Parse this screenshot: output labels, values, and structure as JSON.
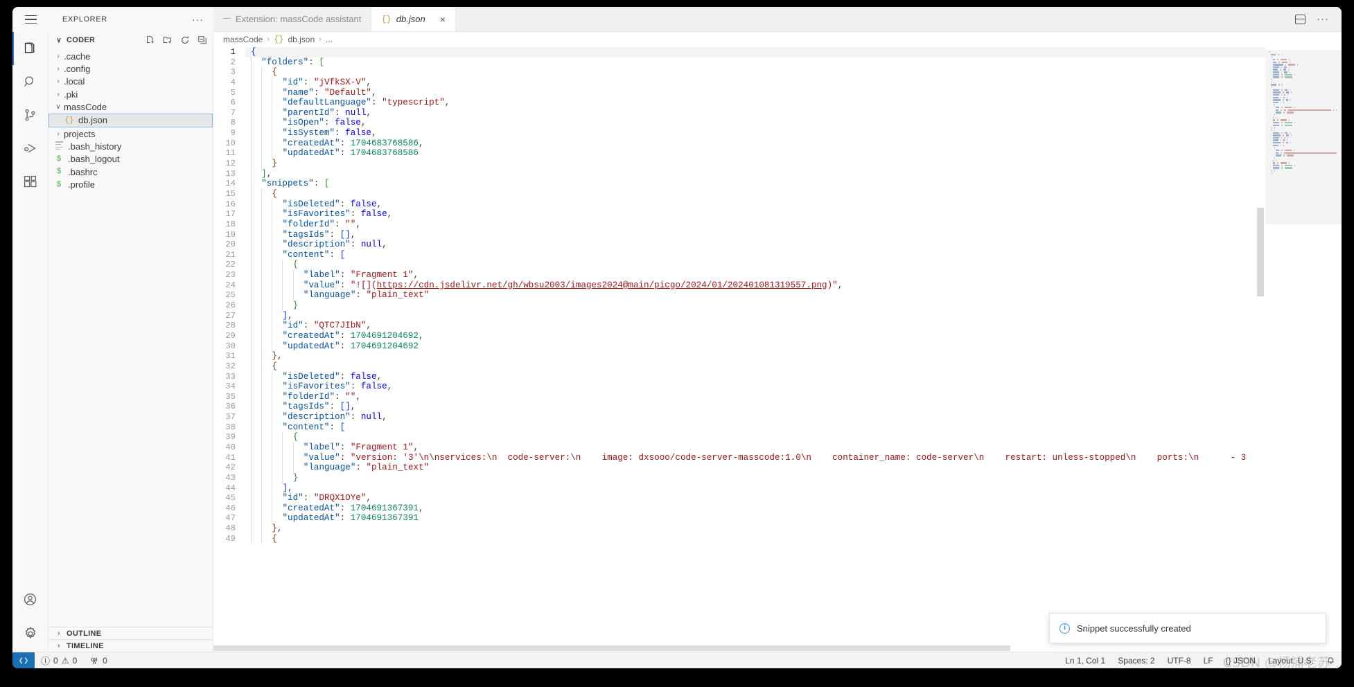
{
  "window": {
    "hamburger_icon": "hamburger-menu-icon"
  },
  "sidebar": {
    "title": "EXPLORER",
    "more_actions": "···",
    "root": {
      "label": "CODER",
      "chevron": "∨",
      "actions": [
        "new-file-icon",
        "new-folder-icon",
        "refresh-icon",
        "collapse-all-icon"
      ]
    },
    "items": [
      {
        "label": ".cache",
        "type": "folder",
        "chevron": "›",
        "icon": "",
        "selected": false
      },
      {
        "label": ".config",
        "type": "folder",
        "chevron": "›",
        "icon": "",
        "selected": false
      },
      {
        "label": ".local",
        "type": "folder",
        "chevron": "›",
        "icon": "",
        "selected": false
      },
      {
        "label": ".pki",
        "type": "folder",
        "chevron": "›",
        "icon": "",
        "selected": false
      },
      {
        "label": "massCode",
        "type": "folder-open",
        "chevron": "∨",
        "icon": "",
        "selected": false
      },
      {
        "label": "db.json",
        "type": "json-file",
        "chevron": "",
        "icon": "{}",
        "selected": true
      },
      {
        "label": "projects",
        "type": "folder",
        "chevron": "›",
        "icon": "",
        "selected": false
      },
      {
        "label": ".bash_history",
        "type": "text-file",
        "chevron": "",
        "icon": "lines",
        "selected": false
      },
      {
        "label": ".bash_logout",
        "type": "shell-file",
        "chevron": "",
        "icon": "$",
        "selected": false
      },
      {
        "label": ".bashrc",
        "type": "shell-file",
        "chevron": "",
        "icon": "$",
        "selected": false
      },
      {
        "label": ".profile",
        "type": "shell-file",
        "chevron": "",
        "icon": "$",
        "selected": false
      }
    ],
    "panels": [
      {
        "label": "OUTLINE",
        "chevron": "›"
      },
      {
        "label": "TIMELINE",
        "chevron": "›"
      }
    ]
  },
  "activitybar": {
    "top": [
      {
        "name": "explorer",
        "icon": "files-icon",
        "active": true
      },
      {
        "name": "search",
        "icon": "search-icon",
        "active": false
      },
      {
        "name": "source-control",
        "icon": "source-control-icon",
        "active": false
      },
      {
        "name": "run-and-debug",
        "icon": "run-debug-icon",
        "active": false
      },
      {
        "name": "extensions",
        "icon": "extensions-icon",
        "active": false
      }
    ],
    "bottom": [
      {
        "name": "accounts",
        "icon": "account-icon"
      },
      {
        "name": "manage",
        "icon": "gear-icon"
      }
    ]
  },
  "tabs": [
    {
      "label": "Extension: massCode assistant",
      "icon": "lines-icon",
      "active": false,
      "closable": false
    },
    {
      "label": "db.json",
      "icon": "json-icon",
      "active": true,
      "closable": true,
      "close_label": "×"
    }
  ],
  "editor_actions": [
    {
      "name": "split-editor-down",
      "icon": "split-editor-icon"
    },
    {
      "name": "more-actions",
      "icon": "ellipsis-icon"
    }
  ],
  "breadcrumb": [
    "massCode",
    "db.json",
    "..."
  ],
  "breadcrumb_icon": "{}",
  "code": {
    "current_line": 1,
    "lines": [
      {
        "n": 1,
        "indent": 0,
        "segs": [
          {
            "t": "{",
            "c": "br1"
          }
        ]
      },
      {
        "n": 2,
        "indent": 1,
        "segs": [
          {
            "t": "\"folders\"",
            "c": "k"
          },
          {
            "t": ": ",
            "c": "p"
          },
          {
            "t": "[",
            "c": "br2"
          }
        ]
      },
      {
        "n": 3,
        "indent": 2,
        "segs": [
          {
            "t": "{",
            "c": "br3"
          }
        ]
      },
      {
        "n": 4,
        "indent": 3,
        "segs": [
          {
            "t": "\"id\"",
            "c": "k"
          },
          {
            "t": ": ",
            "c": "p"
          },
          {
            "t": "\"jVfkSX-V\"",
            "c": "s"
          },
          {
            "t": ",",
            "c": "p"
          }
        ]
      },
      {
        "n": 5,
        "indent": 3,
        "segs": [
          {
            "t": "\"name\"",
            "c": "k"
          },
          {
            "t": ": ",
            "c": "p"
          },
          {
            "t": "\"Default\"",
            "c": "s"
          },
          {
            "t": ",",
            "c": "p"
          }
        ]
      },
      {
        "n": 6,
        "indent": 3,
        "segs": [
          {
            "t": "\"defaultLanguage\"",
            "c": "k"
          },
          {
            "t": ": ",
            "c": "p"
          },
          {
            "t": "\"typescript\"",
            "c": "s"
          },
          {
            "t": ",",
            "c": "p"
          }
        ]
      },
      {
        "n": 7,
        "indent": 3,
        "segs": [
          {
            "t": "\"parentId\"",
            "c": "k"
          },
          {
            "t": ": ",
            "c": "p"
          },
          {
            "t": "null",
            "c": "b"
          },
          {
            "t": ",",
            "c": "p"
          }
        ]
      },
      {
        "n": 8,
        "indent": 3,
        "segs": [
          {
            "t": "\"isOpen\"",
            "c": "k"
          },
          {
            "t": ": ",
            "c": "p"
          },
          {
            "t": "false",
            "c": "b"
          },
          {
            "t": ",",
            "c": "p"
          }
        ]
      },
      {
        "n": 9,
        "indent": 3,
        "segs": [
          {
            "t": "\"isSystem\"",
            "c": "k"
          },
          {
            "t": ": ",
            "c": "p"
          },
          {
            "t": "false",
            "c": "b"
          },
          {
            "t": ",",
            "c": "p"
          }
        ]
      },
      {
        "n": 10,
        "indent": 3,
        "segs": [
          {
            "t": "\"createdAt\"",
            "c": "k"
          },
          {
            "t": ": ",
            "c": "p"
          },
          {
            "t": "1704683768586",
            "c": "n"
          },
          {
            "t": ",",
            "c": "p"
          }
        ]
      },
      {
        "n": 11,
        "indent": 3,
        "segs": [
          {
            "t": "\"updatedAt\"",
            "c": "k"
          },
          {
            "t": ": ",
            "c": "p"
          },
          {
            "t": "1704683768586",
            "c": "n"
          }
        ]
      },
      {
        "n": 12,
        "indent": 2,
        "segs": [
          {
            "t": "}",
            "c": "br3"
          }
        ]
      },
      {
        "n": 13,
        "indent": 1,
        "segs": [
          {
            "t": "]",
            "c": "br2"
          },
          {
            "t": ",",
            "c": "p"
          }
        ]
      },
      {
        "n": 14,
        "indent": 1,
        "segs": [
          {
            "t": "\"snippets\"",
            "c": "k"
          },
          {
            "t": ": ",
            "c": "p"
          },
          {
            "t": "[",
            "c": "br2"
          }
        ]
      },
      {
        "n": 15,
        "indent": 2,
        "segs": [
          {
            "t": "{",
            "c": "br3"
          }
        ]
      },
      {
        "n": 16,
        "indent": 3,
        "segs": [
          {
            "t": "\"isDeleted\"",
            "c": "k"
          },
          {
            "t": ": ",
            "c": "p"
          },
          {
            "t": "false",
            "c": "b"
          },
          {
            "t": ",",
            "c": "p"
          }
        ]
      },
      {
        "n": 17,
        "indent": 3,
        "segs": [
          {
            "t": "\"isFavorites\"",
            "c": "k"
          },
          {
            "t": ": ",
            "c": "p"
          },
          {
            "t": "false",
            "c": "b"
          },
          {
            "t": ",",
            "c": "p"
          }
        ]
      },
      {
        "n": 18,
        "indent": 3,
        "segs": [
          {
            "t": "\"folderId\"",
            "c": "k"
          },
          {
            "t": ": ",
            "c": "p"
          },
          {
            "t": "\"\"",
            "c": "s"
          },
          {
            "t": ",",
            "c": "p"
          }
        ]
      },
      {
        "n": 19,
        "indent": 3,
        "segs": [
          {
            "t": "\"tagsIds\"",
            "c": "k"
          },
          {
            "t": ": ",
            "c": "p"
          },
          {
            "t": "[]",
            "c": "br1"
          },
          {
            "t": ",",
            "c": "p"
          }
        ]
      },
      {
        "n": 20,
        "indent": 3,
        "segs": [
          {
            "t": "\"description\"",
            "c": "k"
          },
          {
            "t": ": ",
            "c": "p"
          },
          {
            "t": "null",
            "c": "b"
          },
          {
            "t": ",",
            "c": "p"
          }
        ]
      },
      {
        "n": 21,
        "indent": 3,
        "segs": [
          {
            "t": "\"content\"",
            "c": "k"
          },
          {
            "t": ": ",
            "c": "p"
          },
          {
            "t": "[",
            "c": "br1"
          }
        ]
      },
      {
        "n": 22,
        "indent": 4,
        "segs": [
          {
            "t": "{",
            "c": "br2"
          }
        ]
      },
      {
        "n": 23,
        "indent": 5,
        "segs": [
          {
            "t": "\"label\"",
            "c": "k"
          },
          {
            "t": ": ",
            "c": "p"
          },
          {
            "t": "\"Fragment 1\"",
            "c": "s"
          },
          {
            "t": ",",
            "c": "p"
          }
        ]
      },
      {
        "n": 24,
        "indent": 5,
        "segs": [
          {
            "t": "\"value\"",
            "c": "k"
          },
          {
            "t": ": ",
            "c": "p"
          },
          {
            "t": "\"![](",
            "c": "s"
          },
          {
            "t": "https://cdn.jsdelivr.net/gh/wbsu2003/images2024@main/picgo/2024/01/202401081319557.png",
            "c": "lnk"
          },
          {
            "t": ")\"",
            "c": "s"
          },
          {
            "t": ",",
            "c": "p"
          }
        ]
      },
      {
        "n": 25,
        "indent": 5,
        "segs": [
          {
            "t": "\"language\"",
            "c": "k"
          },
          {
            "t": ": ",
            "c": "p"
          },
          {
            "t": "\"plain_text\"",
            "c": "s"
          }
        ]
      },
      {
        "n": 26,
        "indent": 4,
        "segs": [
          {
            "t": "}",
            "c": "br2"
          }
        ]
      },
      {
        "n": 27,
        "indent": 3,
        "segs": [
          {
            "t": "]",
            "c": "br1"
          },
          {
            "t": ",",
            "c": "p"
          }
        ]
      },
      {
        "n": 28,
        "indent": 3,
        "segs": [
          {
            "t": "\"id\"",
            "c": "k"
          },
          {
            "t": ": ",
            "c": "p"
          },
          {
            "t": "\"QTC7JIbN\"",
            "c": "s"
          },
          {
            "t": ",",
            "c": "p"
          }
        ]
      },
      {
        "n": 29,
        "indent": 3,
        "segs": [
          {
            "t": "\"createdAt\"",
            "c": "k"
          },
          {
            "t": ": ",
            "c": "p"
          },
          {
            "t": "1704691204692",
            "c": "n"
          },
          {
            "t": ",",
            "c": "p"
          }
        ]
      },
      {
        "n": 30,
        "indent": 3,
        "segs": [
          {
            "t": "\"updatedAt\"",
            "c": "k"
          },
          {
            "t": ": ",
            "c": "p"
          },
          {
            "t": "1704691204692",
            "c": "n"
          }
        ]
      },
      {
        "n": 31,
        "indent": 2,
        "segs": [
          {
            "t": "}",
            "c": "br3"
          },
          {
            "t": ",",
            "c": "p"
          }
        ]
      },
      {
        "n": 32,
        "indent": 2,
        "segs": [
          {
            "t": "{",
            "c": "br3"
          }
        ]
      },
      {
        "n": 33,
        "indent": 3,
        "segs": [
          {
            "t": "\"isDeleted\"",
            "c": "k"
          },
          {
            "t": ": ",
            "c": "p"
          },
          {
            "t": "false",
            "c": "b"
          },
          {
            "t": ",",
            "c": "p"
          }
        ]
      },
      {
        "n": 34,
        "indent": 3,
        "segs": [
          {
            "t": "\"isFavorites\"",
            "c": "k"
          },
          {
            "t": ": ",
            "c": "p"
          },
          {
            "t": "false",
            "c": "b"
          },
          {
            "t": ",",
            "c": "p"
          }
        ]
      },
      {
        "n": 35,
        "indent": 3,
        "segs": [
          {
            "t": "\"folderId\"",
            "c": "k"
          },
          {
            "t": ": ",
            "c": "p"
          },
          {
            "t": "\"\"",
            "c": "s"
          },
          {
            "t": ",",
            "c": "p"
          }
        ]
      },
      {
        "n": 36,
        "indent": 3,
        "segs": [
          {
            "t": "\"tagsIds\"",
            "c": "k"
          },
          {
            "t": ": ",
            "c": "p"
          },
          {
            "t": "[]",
            "c": "br1"
          },
          {
            "t": ",",
            "c": "p"
          }
        ]
      },
      {
        "n": 37,
        "indent": 3,
        "segs": [
          {
            "t": "\"description\"",
            "c": "k"
          },
          {
            "t": ": ",
            "c": "p"
          },
          {
            "t": "null",
            "c": "b"
          },
          {
            "t": ",",
            "c": "p"
          }
        ]
      },
      {
        "n": 38,
        "indent": 3,
        "segs": [
          {
            "t": "\"content\"",
            "c": "k"
          },
          {
            "t": ": ",
            "c": "p"
          },
          {
            "t": "[",
            "c": "br1"
          }
        ]
      },
      {
        "n": 39,
        "indent": 4,
        "segs": [
          {
            "t": "{",
            "c": "br2"
          }
        ]
      },
      {
        "n": 40,
        "indent": 5,
        "segs": [
          {
            "t": "\"label\"",
            "c": "k"
          },
          {
            "t": ": ",
            "c": "p"
          },
          {
            "t": "\"Fragment 1\"",
            "c": "s"
          },
          {
            "t": ",",
            "c": "p"
          }
        ]
      },
      {
        "n": 41,
        "indent": 5,
        "segs": [
          {
            "t": "\"value\"",
            "c": "k"
          },
          {
            "t": ": ",
            "c": "p"
          },
          {
            "t": "\"version: '3'\\n\\nservices:\\n  code-server:\\n    image: dxsooo/code-server-masscode:1.0\\n    container_name: code-server\\n    restart: unless-stopped\\n    ports:\\n      - 3",
            "c": "s"
          }
        ]
      },
      {
        "n": 42,
        "indent": 5,
        "segs": [
          {
            "t": "\"language\"",
            "c": "k"
          },
          {
            "t": ": ",
            "c": "p"
          },
          {
            "t": "\"plain_text\"",
            "c": "s"
          }
        ]
      },
      {
        "n": 43,
        "indent": 4,
        "segs": [
          {
            "t": "}",
            "c": "br2"
          }
        ]
      },
      {
        "n": 44,
        "indent": 3,
        "segs": [
          {
            "t": "]",
            "c": "br1"
          },
          {
            "t": ",",
            "c": "p"
          }
        ]
      },
      {
        "n": 45,
        "indent": 3,
        "segs": [
          {
            "t": "\"id\"",
            "c": "k"
          },
          {
            "t": ": ",
            "c": "p"
          },
          {
            "t": "\"DRQX1OYe\"",
            "c": "s"
          },
          {
            "t": ",",
            "c": "p"
          }
        ]
      },
      {
        "n": 46,
        "indent": 3,
        "segs": [
          {
            "t": "\"createdAt\"",
            "c": "k"
          },
          {
            "t": ": ",
            "c": "p"
          },
          {
            "t": "1704691367391",
            "c": "n"
          },
          {
            "t": ",",
            "c": "p"
          }
        ]
      },
      {
        "n": 47,
        "indent": 3,
        "segs": [
          {
            "t": "\"updatedAt\"",
            "c": "k"
          },
          {
            "t": ": ",
            "c": "p"
          },
          {
            "t": "1704691367391",
            "c": "n"
          }
        ]
      },
      {
        "n": 48,
        "indent": 2,
        "segs": [
          {
            "t": "}",
            "c": "br3"
          },
          {
            "t": ",",
            "c": "p"
          }
        ]
      },
      {
        "n": 49,
        "indent": 2,
        "segs": [
          {
            "t": "{",
            "c": "br3"
          }
        ]
      }
    ]
  },
  "notification": {
    "icon": "info-icon",
    "glyph": "i",
    "message": "Snippet successfully created"
  },
  "statusbar": {
    "remote_icon": "remote-host-icon",
    "left": [
      {
        "name": "problems",
        "icon": "error-icon",
        "errors": "0",
        "warnings": "0"
      },
      {
        "name": "ports",
        "icon": "radio-tower-icon",
        "value": "0"
      }
    ],
    "error_glyph": "⊗",
    "warn_glyph": "⚠",
    "right": [
      {
        "name": "editor-position",
        "label": "Ln 1, Col 1"
      },
      {
        "name": "editor-indentation",
        "label": "Spaces: 2"
      },
      {
        "name": "editor-encoding",
        "label": "UTF-8"
      },
      {
        "name": "editor-eol",
        "label": "LF"
      },
      {
        "name": "editor-language",
        "label": "{} JSON"
      },
      {
        "name": "keyboard-layout",
        "label": "Layout: U.S."
      }
    ],
    "bell_icon": "bell-icon",
    "watermark": "CSDN @杨浦老苏"
  },
  "colors": {
    "accent": "#1a7fd4",
    "remote_bg": "#1a6fb5",
    "selection_border": "#8fb9e8",
    "json_key": "#0451a5",
    "json_string": "#a31515",
    "json_number": "#098658",
    "json_bool": "#0000ff"
  }
}
